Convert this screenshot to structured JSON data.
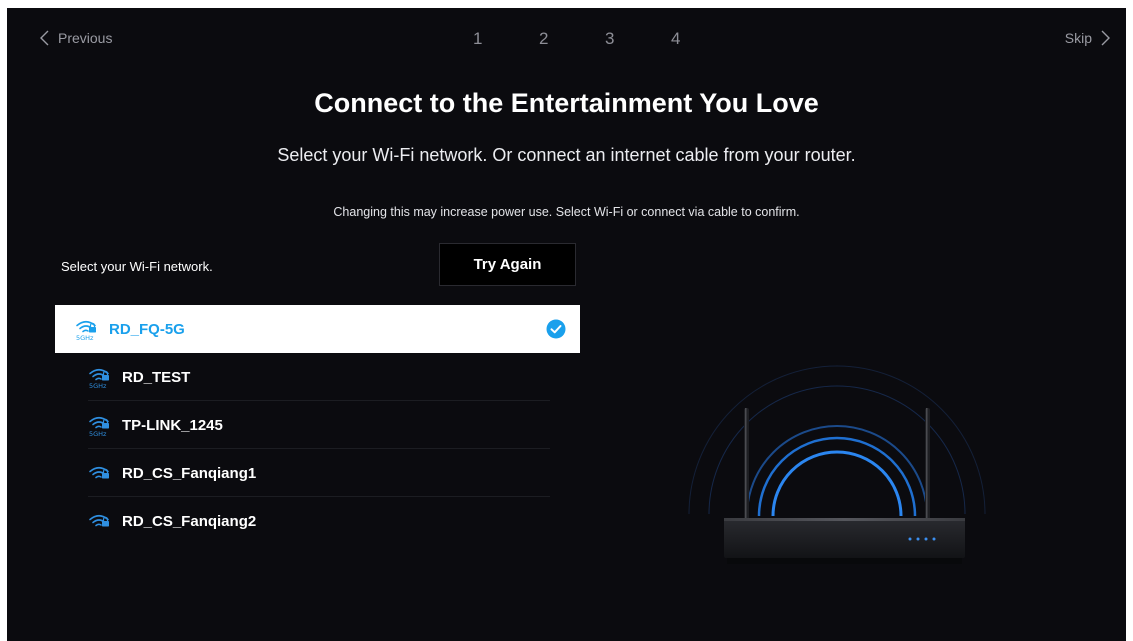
{
  "nav": {
    "previous_label": "Previous",
    "skip_label": "Skip",
    "steps": [
      "1",
      "2",
      "3",
      "4"
    ]
  },
  "header": {
    "title": "Connect to the Entertainment You Love",
    "subtitle": "Select your Wi-Fi network. Or connect an internet cable from your router.",
    "note": "Changing this may increase power use. Select Wi-Fi or connect via cable to confirm."
  },
  "wifi": {
    "label": "Select your Wi-Fi network.",
    "try_again_label": "Try Again",
    "networks": [
      {
        "name": "RD_FQ-5G",
        "band": "5GHz",
        "selected": true
      },
      {
        "name": "RD_TEST",
        "band": "5GHz",
        "selected": false
      },
      {
        "name": "TP-LINK_1245",
        "band": "5GHz",
        "selected": false
      },
      {
        "name": "RD_CS_Fanqiang1",
        "band": "",
        "selected": false
      },
      {
        "name": "RD_CS_Fanqiang2",
        "band": "",
        "selected": false
      }
    ]
  },
  "colors": {
    "background": "#0b0b0f",
    "accent": "#1aa0ec",
    "selected_row": "#ffffff"
  },
  "icons": [
    "chevron-left-icon",
    "chevron-right-icon",
    "wifi-lock-icon",
    "checkmark-icon",
    "router-illustration"
  ]
}
